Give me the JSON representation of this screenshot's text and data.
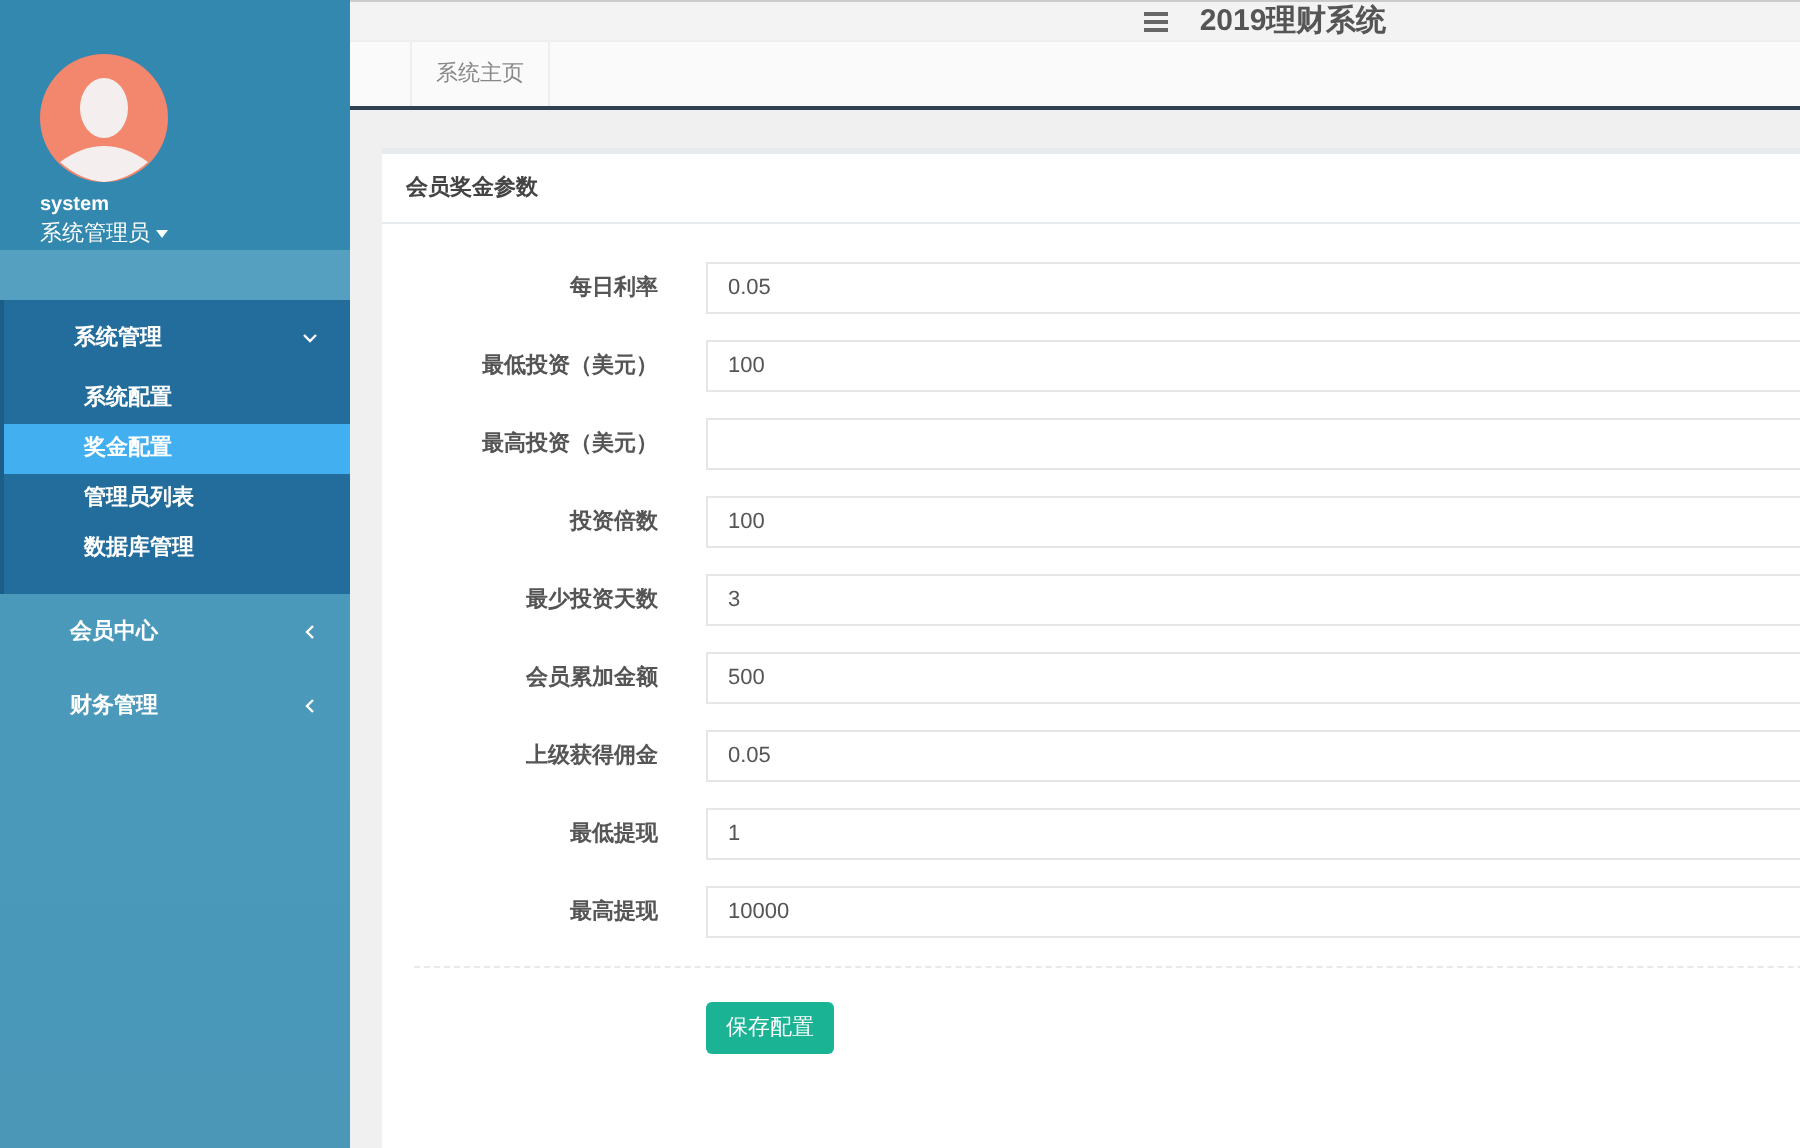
{
  "user": {
    "name": "system",
    "role": "系统管理员"
  },
  "menu": [
    {
      "label": "系统管理",
      "expanded": true,
      "children": [
        {
          "label": "系统配置",
          "selected": false
        },
        {
          "label": "奖金配置",
          "selected": true
        },
        {
          "label": "管理员列表",
          "selected": false
        },
        {
          "label": "数据库管理",
          "selected": false
        }
      ]
    },
    {
      "label": "会员中心",
      "expanded": false
    },
    {
      "label": "财务管理",
      "expanded": false
    }
  ],
  "header": {
    "title": "2019理财系统"
  },
  "tabs": [
    {
      "label": "系统主页",
      "selected": false
    }
  ],
  "card": {
    "title": "会员奖金参数",
    "fields": [
      {
        "label": "每日利率",
        "value": "0.05"
      },
      {
        "label": "最低投资（美元）",
        "value": "100"
      },
      {
        "label": "最高投资（美元）"
      },
      {
        "label": "投资倍数",
        "value": "100"
      },
      {
        "label": "最少投资天数",
        "value": "3"
      },
      {
        "label": "会员累加金额",
        "value": "500"
      },
      {
        "label": "上级获得佣金",
        "value": "0.05"
      },
      {
        "label": "最低提现",
        "value": "1"
      },
      {
        "label": "最高提现",
        "value": "10000"
      }
    ],
    "button": "保存配置"
  }
}
